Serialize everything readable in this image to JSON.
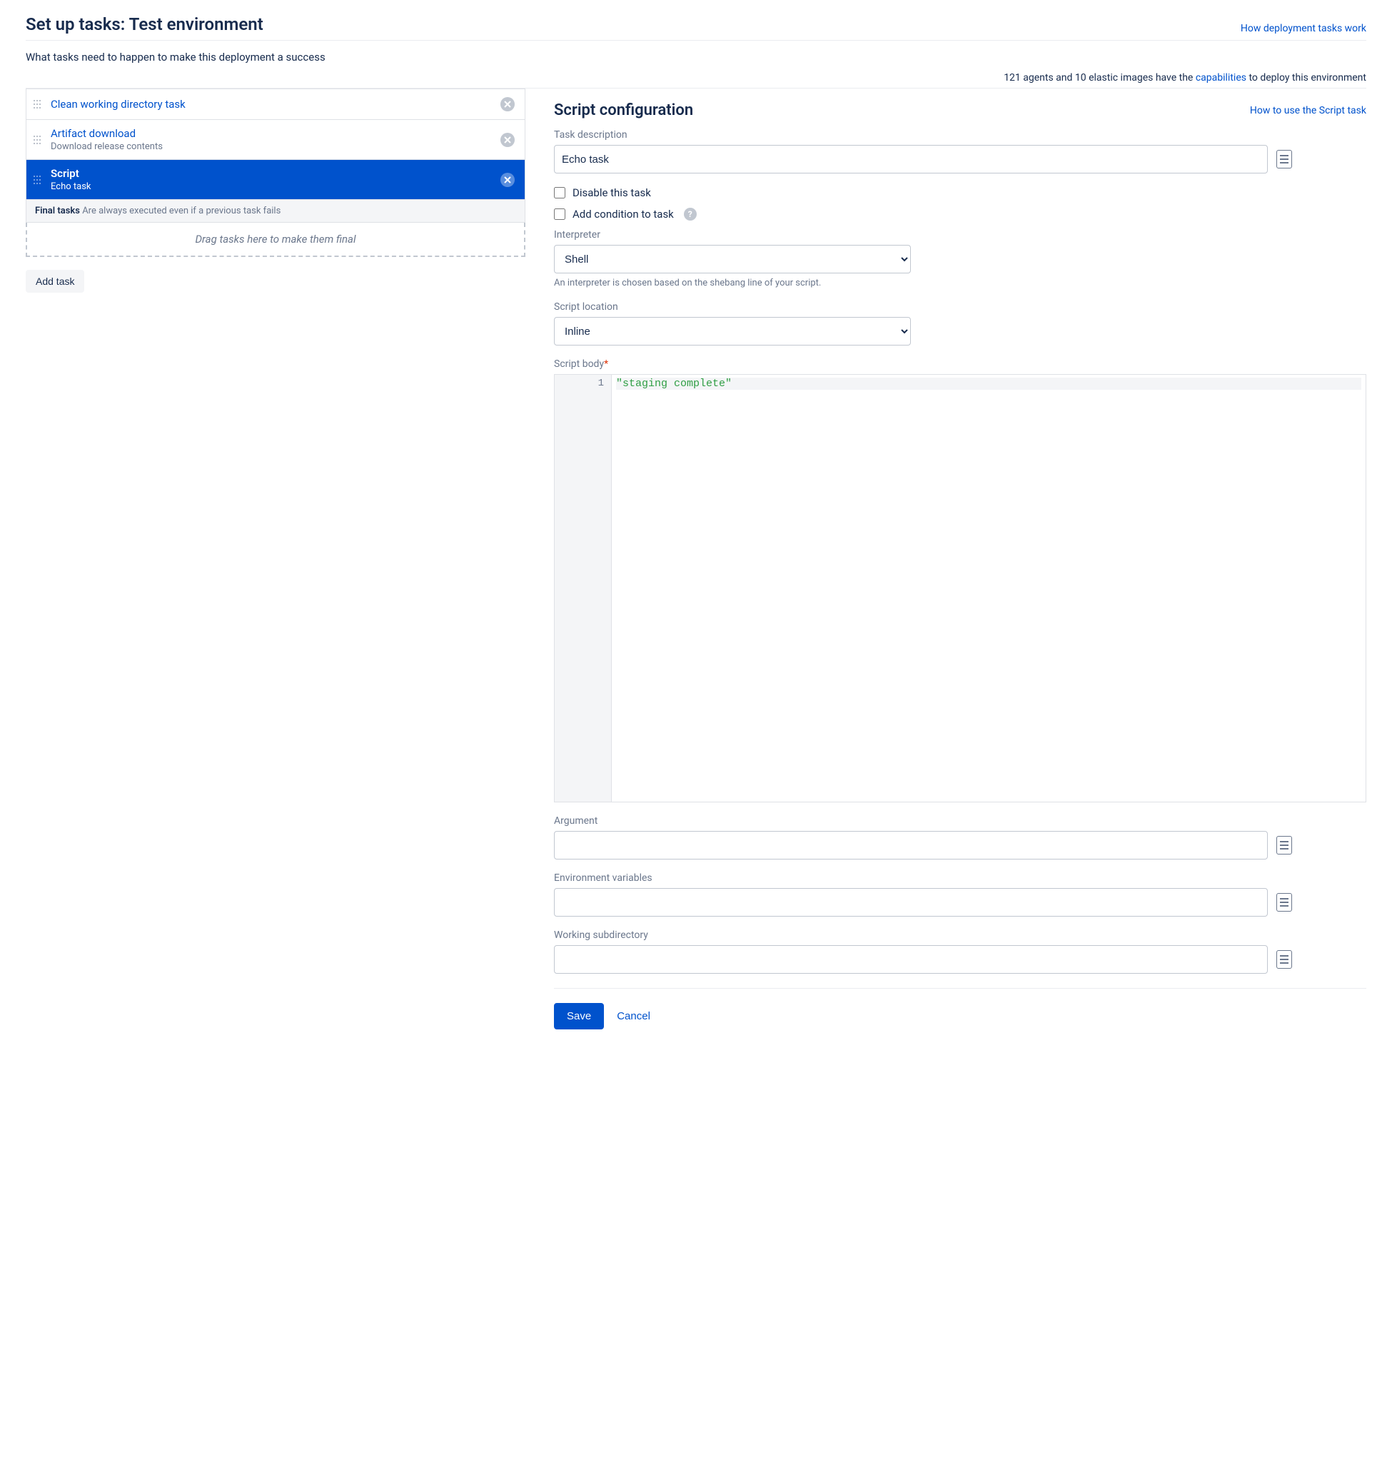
{
  "header": {
    "title": "Set up tasks: Test environment",
    "help_link": "How deployment tasks work",
    "subtitle": "What tasks need to happen to make this deployment a success"
  },
  "agents": {
    "prefix": "121 agents and 10 elastic images have the ",
    "link": "capabilities",
    "suffix": " to deploy this environment"
  },
  "tasks": [
    {
      "title": "Clean working directory task",
      "sub": "",
      "selected": false
    },
    {
      "title": "Artifact download",
      "sub": "Download release contents",
      "selected": false
    },
    {
      "title": "Script",
      "sub": "Echo task",
      "selected": true
    }
  ],
  "final_tasks": {
    "label": "Final tasks",
    "hint": "Are always executed even if a previous task fails",
    "dropzone": "Drag tasks here to make them final"
  },
  "add_task_label": "Add task",
  "config": {
    "title": "Script configuration",
    "help_link": "How to use the Script task",
    "desc_label": "Task description",
    "desc_value": "Echo task",
    "disable_label": "Disable this task",
    "condition_label": "Add condition to task",
    "interpreter_label": "Interpreter",
    "interpreter_value": "Shell",
    "interpreter_hint": "An interpreter is chosen based on the shebang line of your script.",
    "location_label": "Script location",
    "location_value": "Inline",
    "body_label": "Script body",
    "body_line_no": "1",
    "body_code": "\"staging complete\"",
    "argument_label": "Argument",
    "argument_value": "",
    "env_label": "Environment variables",
    "env_value": "",
    "workdir_label": "Working subdirectory",
    "workdir_value": "",
    "save_label": "Save",
    "cancel_label": "Cancel"
  }
}
